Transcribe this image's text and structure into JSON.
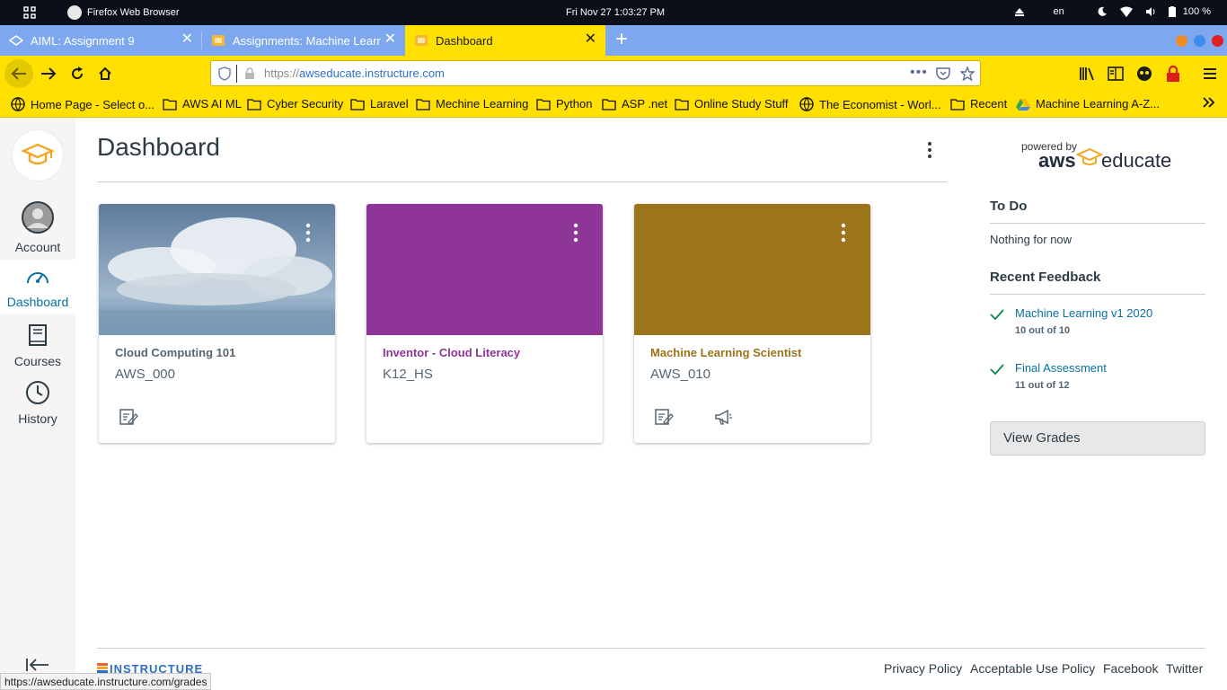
{
  "os": {
    "app_title": "Firefox Web Browser",
    "clock": "Fri Nov 27   1:03:27 PM",
    "lang": "en",
    "battery": "100 %"
  },
  "tabs": [
    {
      "label": "AIML: Assignment 9",
      "active": false
    },
    {
      "label": "Assignments: Machine Learn",
      "active": false
    },
    {
      "label": "Dashboard",
      "active": true
    }
  ],
  "urlbar": {
    "prefix": "https://",
    "host": "awseducate.instructure.com"
  },
  "bookmarks": [
    {
      "label": "Home Page - Select o...",
      "icon": "globe-icon"
    },
    {
      "label": "AWS AI ML",
      "icon": "folder-icon"
    },
    {
      "label": "Cyber Security",
      "icon": "folder-icon"
    },
    {
      "label": "Laravel",
      "icon": "folder-icon"
    },
    {
      "label": "Mechine Learning",
      "icon": "folder-icon"
    },
    {
      "label": "Python",
      "icon": "folder-icon"
    },
    {
      "label": "ASP .net",
      "icon": "folder-icon"
    },
    {
      "label": "Online Study Stuff",
      "icon": "folder-icon"
    },
    {
      "label": "The Economist - Worl...",
      "icon": "globe-icon"
    },
    {
      "label": "Recent",
      "icon": "folder-icon"
    },
    {
      "label": "Machine Learning A-Z...",
      "icon": "drive-icon"
    }
  ],
  "sidebar": {
    "items": [
      {
        "label": "Account"
      },
      {
        "label": "Dashboard"
      },
      {
        "label": "Courses"
      },
      {
        "label": "History"
      }
    ]
  },
  "main": {
    "title": "Dashboard",
    "cards": [
      {
        "title": "Cloud Computing 101",
        "code": "AWS_000",
        "color": "#4a6b8c",
        "title_color": "#556572"
      },
      {
        "title": "Inventor - Cloud Literacy",
        "code": "K12_HS",
        "color": "#8f3598",
        "title_color": "#8f3598"
      },
      {
        "title": "Machine Learning Scientist",
        "code": "AWS_010",
        "color": "#9c7419",
        "title_color": "#9c7419"
      }
    ]
  },
  "right": {
    "logo_powered": "powered by",
    "logo_aws": "aws",
    "logo_educate": "educate",
    "todo_title": "To Do",
    "todo_empty": "Nothing for now",
    "feedback_title": "Recent Feedback",
    "feedback": [
      {
        "title": "Machine Learning v1 2020",
        "score": "10 out of 10"
      },
      {
        "title": "Final Assessment",
        "score": "11 out of 12"
      }
    ],
    "view_grades": "View Grades"
  },
  "footer": {
    "brand": "INSTRUCTURE",
    "links": [
      "Privacy Policy",
      "Acceptable Use Policy",
      "Facebook",
      "Twitter"
    ]
  },
  "status_url": "https://awseducate.instructure.com/grades",
  "colors": {
    "browser_yellow": "#ffe000",
    "tab_blue": "#7da8ef",
    "canvas_link": "#0770a3"
  }
}
